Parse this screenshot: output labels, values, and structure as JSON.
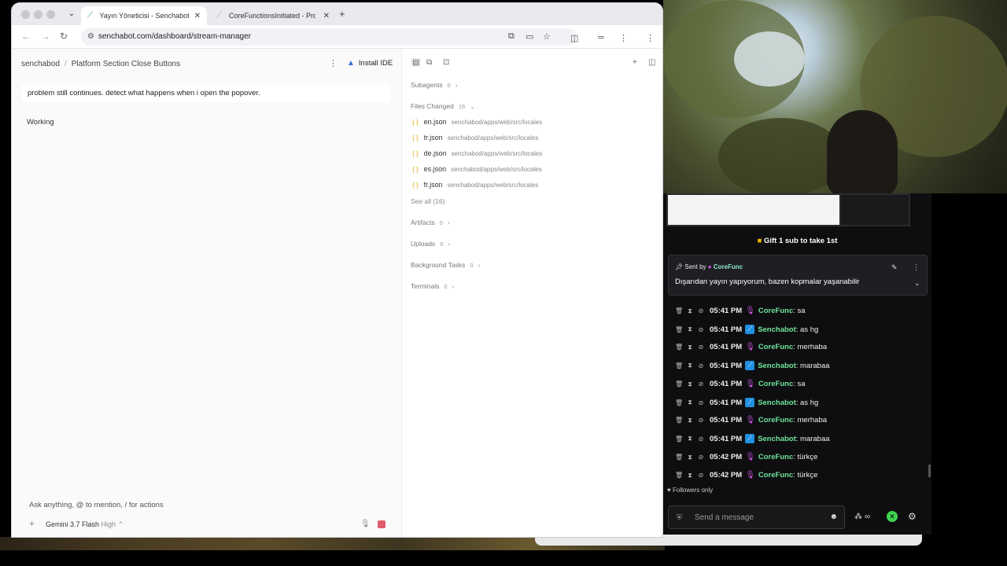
{
  "browser": {
    "tabs": [
      {
        "title": "Yayın Yöneticisi - Senchabot",
        "active": true
      },
      {
        "title": "CoreFunctionsInitiated - Prof",
        "active": false
      }
    ],
    "url": "senchabot.com/dashboard/stream-manager"
  },
  "app": {
    "breadcrumb": {
      "workspace": "senchabod",
      "page": "Platform Section Close Buttons"
    },
    "install_label": "Install IDE",
    "user_message": "problem still continues. detect what happens when i open the popover.",
    "status": "Working",
    "composer_placeholder": "Ask anything, @ to mention, / for actions",
    "model": {
      "name": "Gemini 3.7 Flash",
      "level": "High"
    }
  },
  "side": {
    "subagents": {
      "label": "Subagents",
      "count": "0"
    },
    "files_changed": {
      "label": "Files Changed",
      "count": "16"
    },
    "files": [
      {
        "name": "en.json",
        "path": "senchabod/apps/web/src/locales"
      },
      {
        "name": "tr.json",
        "path": "senchabod/apps/web/src/locales"
      },
      {
        "name": "de.json",
        "path": "senchabod/apps/web/src/locales"
      },
      {
        "name": "es.json",
        "path": "senchabod/apps/web/src/locales"
      },
      {
        "name": "fr.json",
        "path": "senchabod/apps/web/src/locales"
      }
    ],
    "see_all": "See all (16)",
    "artifacts": {
      "label": "Artifacts",
      "count": "0"
    },
    "uploads": {
      "label": "Uploads",
      "count": "0"
    },
    "background_tasks": {
      "label": "Background Tasks",
      "count": "0"
    },
    "terminals": {
      "label": "Terminals",
      "count": "0"
    }
  },
  "chat": {
    "gift_text": "Gift 1 sub to take 1st",
    "pinned": {
      "prefix": "Sent by",
      "author": "CoreFunc",
      "text": "Dışarıdan yayın yapıyorum, bazen kopmalar yaşanabilir"
    },
    "messages": [
      {
        "time": "05:41 PM",
        "user": "CoreFunc",
        "text": ": sa",
        "color": "#6fe39b",
        "badge": "mic"
      },
      {
        "time": "05:41 PM",
        "user": "Senchabot",
        "text": ": as hg",
        "color": "#6fe39b",
        "badge": "bot"
      },
      {
        "time": "05:41 PM",
        "user": "CoreFunc",
        "text": ": merhaba",
        "color": "#6fe39b",
        "badge": "mic"
      },
      {
        "time": "05:41 PM",
        "user": "Senchabot",
        "text": ": marabaa",
        "color": "#6fe39b",
        "badge": "bot"
      },
      {
        "time": "05:41 PM",
        "user": "CoreFunc",
        "text": ": sa",
        "color": "#6fe39b",
        "badge": "mic"
      },
      {
        "time": "05:41 PM",
        "user": "Senchabot",
        "text": ": as hg",
        "color": "#6fe39b",
        "badge": "bot"
      },
      {
        "time": "05:41 PM",
        "user": "CoreFunc",
        "text": ": merhaba",
        "color": "#6fe39b",
        "badge": "mic"
      },
      {
        "time": "05:41 PM",
        "user": "Senchabot",
        "text": ": marabaa",
        "color": "#6fe39b",
        "badge": "bot"
      },
      {
        "time": "05:42 PM",
        "user": "CoreFunc",
        "text": ": türkçe",
        "color": "#6fe39b",
        "badge": "mic"
      },
      {
        "time": "05:42 PM",
        "user": "CoreFunc",
        "text": ": türkçe",
        "color": "#6fe39b",
        "badge": "mic"
      }
    ],
    "followers_only": "Followers only",
    "input_placeholder": "Send a message"
  }
}
